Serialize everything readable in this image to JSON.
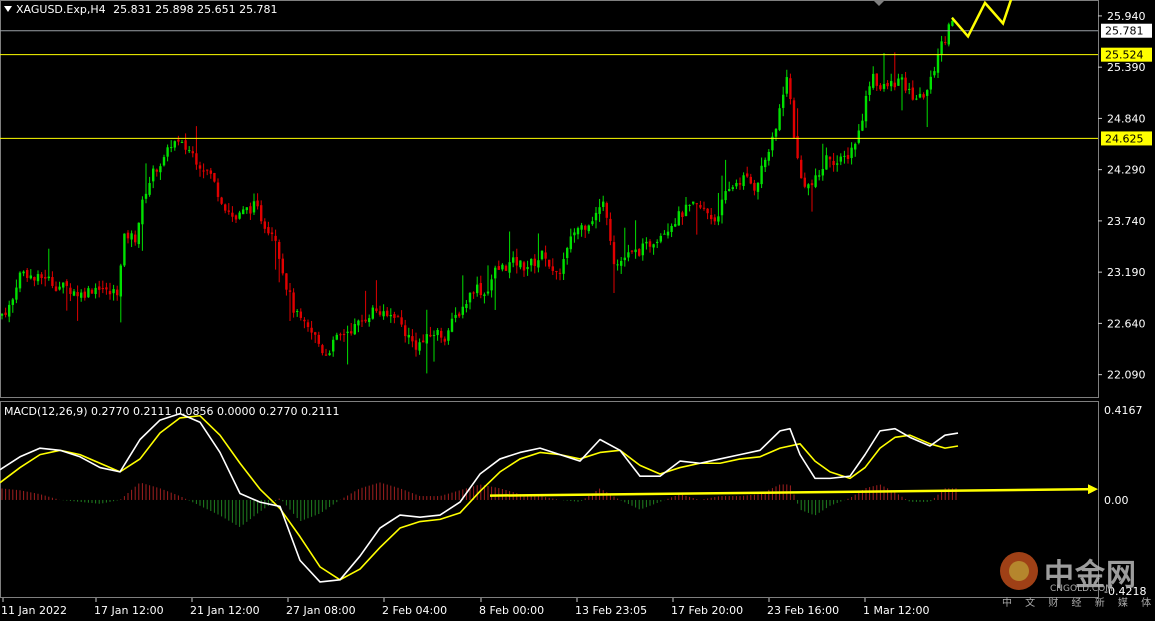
{
  "header": {
    "symbol": "XAGUSD.Exp,H4",
    "ohlc": "25.831 25.898 25.651 25.781"
  },
  "macd": {
    "label": "MACD(12,26,9) 0.2770 0.2111 0.0856 0.0000 0.2770 0.2111",
    "axis_labels": [
      "0.4167",
      "0.00",
      "-0.4218"
    ]
  },
  "watermark": {
    "brand": "中金网",
    "site": "CNGOLD.COM",
    "tagline": "中 文 财 经 新 媒 体"
  },
  "colors": {
    "background": "#000000",
    "bull_candle": "#00e000",
    "bear_candle": "#e00000",
    "level_line": "#ffff00",
    "current_price_line": "#9aa0a6",
    "macd_line": "#ffffff",
    "signal_line": "#ffff00",
    "hist_positive": "#a02020",
    "hist_negative": "#208020",
    "arrow": "#ffff00"
  },
  "chart_data": [
    {
      "type": "candlestick",
      "title": "XAGUSD.Exp,H4",
      "y_ticks": [
        22.09,
        22.64,
        23.19,
        23.74,
        24.29,
        24.84,
        25.39,
        25.94
      ],
      "ylim": [
        21.85,
        26.1
      ],
      "x_ticks": [
        "11 Jan 2022",
        "17 Jan 12:00",
        "21 Jan 12:00",
        "27 Jan 08:00",
        "2 Feb 04:00",
        "8 Feb 00:00",
        "13 Feb 23:05",
        "17 Feb 20:00",
        "23 Feb 16:00",
        "1 Mar 12:00"
      ],
      "current_price": 25.781,
      "current_price_label": "25.781",
      "levels": [
        {
          "value": 25.524,
          "label": "25.524"
        },
        {
          "value": 24.625,
          "label": "24.625"
        }
      ],
      "close_path": [
        [
          0,
          22.72
        ],
        [
          12,
          22.85
        ],
        [
          18,
          23.15
        ],
        [
          25,
          23.2
        ],
        [
          35,
          23.1
        ],
        [
          45,
          23.15
        ],
        [
          55,
          23.05
        ],
        [
          68,
          23.02
        ],
        [
          80,
          22.95
        ],
        [
          90,
          23.0
        ],
        [
          100,
          23.05
        ],
        [
          108,
          22.95
        ],
        [
          118,
          23.0
        ],
        [
          125,
          23.6
        ],
        [
          135,
          23.55
        ],
        [
          145,
          24.05
        ],
        [
          155,
          24.3
        ],
        [
          165,
          24.4
        ],
        [
          172,
          24.6
        ],
        [
          180,
          24.55
        ],
        [
          190,
          24.5
        ],
        [
          200,
          24.35
        ],
        [
          210,
          24.25
        ],
        [
          218,
          24.05
        ],
        [
          225,
          23.9
        ],
        [
          235,
          23.75
        ],
        [
          245,
          23.85
        ],
        [
          255,
          23.9
        ],
        [
          265,
          23.7
        ],
        [
          275,
          23.6
        ],
        [
          285,
          23.1
        ],
        [
          295,
          22.75
        ],
        [
          305,
          22.6
        ],
        [
          315,
          22.5
        ],
        [
          325,
          22.3
        ],
        [
          335,
          22.45
        ],
        [
          345,
          22.55
        ],
        [
          355,
          22.6
        ],
        [
          365,
          22.7
        ],
        [
          375,
          22.8
        ],
        [
          385,
          22.7
        ],
        [
          395,
          22.75
        ],
        [
          405,
          22.55
        ],
        [
          415,
          22.4
        ],
        [
          425,
          22.45
        ],
        [
          435,
          22.55
        ],
        [
          445,
          22.5
        ],
        [
          455,
          22.7
        ],
        [
          465,
          22.85
        ],
        [
          475,
          23.05
        ],
        [
          485,
          22.95
        ],
        [
          495,
          23.2
        ],
        [
          505,
          23.25
        ],
        [
          515,
          23.3
        ],
        [
          525,
          23.25
        ],
        [
          535,
          23.3
        ],
        [
          545,
          23.4
        ],
        [
          555,
          23.1
        ],
        [
          565,
          23.35
        ],
        [
          575,
          23.65
        ],
        [
          585,
          23.7
        ],
        [
          595,
          23.8
        ],
        [
          605,
          23.95
        ],
        [
          615,
          23.25
        ],
        [
          625,
          23.35
        ],
        [
          635,
          23.4
        ],
        [
          645,
          23.45
        ],
        [
          655,
          23.55
        ],
        [
          665,
          23.65
        ],
        [
          675,
          23.75
        ],
        [
          685,
          23.85
        ],
        [
          695,
          23.9
        ],
        [
          705,
          23.85
        ],
        [
          715,
          23.75
        ],
        [
          725,
          24.0
        ],
        [
          735,
          24.15
        ],
        [
          745,
          24.2
        ],
        [
          755,
          24.1
        ],
        [
          765,
          24.4
        ],
        [
          775,
          24.65
        ],
        [
          782,
          25.1
        ],
        [
          788,
          25.3
        ],
        [
          793,
          24.75
        ],
        [
          800,
          24.2
        ],
        [
          810,
          24.1
        ],
        [
          818,
          24.2
        ],
        [
          828,
          24.45
        ],
        [
          838,
          24.35
        ],
        [
          848,
          24.45
        ],
        [
          858,
          24.65
        ],
        [
          865,
          25.0
        ],
        [
          872,
          25.35
        ],
        [
          880,
          25.15
        ],
        [
          890,
          25.2
        ],
        [
          900,
          25.25
        ],
        [
          910,
          25.1
        ],
        [
          920,
          25.05
        ],
        [
          930,
          25.2
        ],
        [
          938,
          25.55
        ],
        [
          945,
          25.7
        ],
        [
          950,
          25.95
        ],
        [
          955,
          25.78
        ]
      ],
      "forecast_arrow_path": [
        [
          952,
          25.92
        ],
        [
          968,
          25.72
        ],
        [
          985,
          26.08
        ],
        [
          1003,
          25.86
        ],
        [
          1020,
          26.4
        ]
      ]
    },
    {
      "type": "macd",
      "title": "MACD(12,26,9)",
      "params": [
        12,
        26,
        9
      ],
      "values": {
        "macd": 0.277,
        "signal": 0.2111,
        "histogram": 0.0856
      },
      "ylim": [
        -0.4218,
        0.4167
      ],
      "macd_line": [
        [
          0,
          0.14
        ],
        [
          20,
          0.2
        ],
        [
          40,
          0.24
        ],
        [
          60,
          0.23
        ],
        [
          80,
          0.2
        ],
        [
          100,
          0.15
        ],
        [
          120,
          0.13
        ],
        [
          140,
          0.28
        ],
        [
          160,
          0.37
        ],
        [
          180,
          0.4
        ],
        [
          200,
          0.36
        ],
        [
          220,
          0.22
        ],
        [
          240,
          0.03
        ],
        [
          260,
          -0.01
        ],
        [
          280,
          -0.03
        ],
        [
          300,
          -0.28
        ],
        [
          320,
          -0.38
        ],
        [
          340,
          -0.37
        ],
        [
          360,
          -0.26
        ],
        [
          380,
          -0.13
        ],
        [
          400,
          -0.07
        ],
        [
          420,
          -0.08
        ],
        [
          440,
          -0.07
        ],
        [
          460,
          -0.01
        ],
        [
          480,
          0.12
        ],
        [
          500,
          0.19
        ],
        [
          520,
          0.22
        ],
        [
          540,
          0.24
        ],
        [
          560,
          0.21
        ],
        [
          580,
          0.18
        ],
        [
          600,
          0.28
        ],
        [
          620,
          0.23
        ],
        [
          640,
          0.11
        ],
        [
          660,
          0.11
        ],
        [
          680,
          0.18
        ],
        [
          700,
          0.17
        ],
        [
          720,
          0.19
        ],
        [
          740,
          0.21
        ],
        [
          760,
          0.23
        ],
        [
          780,
          0.32
        ],
        [
          790,
          0.33
        ],
        [
          800,
          0.21
        ],
        [
          815,
          0.1
        ],
        [
          830,
          0.1
        ],
        [
          850,
          0.11
        ],
        [
          865,
          0.21
        ],
        [
          880,
          0.32
        ],
        [
          895,
          0.33
        ],
        [
          910,
          0.29
        ],
        [
          930,
          0.25
        ],
        [
          945,
          0.3
        ],
        [
          958,
          0.31
        ]
      ],
      "signal_line": [
        [
          0,
          0.08
        ],
        [
          20,
          0.15
        ],
        [
          40,
          0.21
        ],
        [
          60,
          0.23
        ],
        [
          80,
          0.21
        ],
        [
          100,
          0.17
        ],
        [
          120,
          0.13
        ],
        [
          140,
          0.19
        ],
        [
          160,
          0.31
        ],
        [
          180,
          0.38
        ],
        [
          200,
          0.39
        ],
        [
          220,
          0.3
        ],
        [
          240,
          0.17
        ],
        [
          260,
          0.05
        ],
        [
          280,
          -0.04
        ],
        [
          300,
          -0.17
        ],
        [
          320,
          -0.31
        ],
        [
          340,
          -0.37
        ],
        [
          360,
          -0.32
        ],
        [
          380,
          -0.22
        ],
        [
          400,
          -0.13
        ],
        [
          420,
          -0.1
        ],
        [
          440,
          -0.09
        ],
        [
          460,
          -0.06
        ],
        [
          480,
          0.04
        ],
        [
          500,
          0.13
        ],
        [
          520,
          0.19
        ],
        [
          540,
          0.22
        ],
        [
          560,
          0.21
        ],
        [
          580,
          0.19
        ],
        [
          600,
          0.22
        ],
        [
          620,
          0.23
        ],
        [
          640,
          0.16
        ],
        [
          660,
          0.12
        ],
        [
          680,
          0.15
        ],
        [
          700,
          0.17
        ],
        [
          720,
          0.17
        ],
        [
          740,
          0.19
        ],
        [
          760,
          0.2
        ],
        [
          780,
          0.24
        ],
        [
          800,
          0.26
        ],
        [
          815,
          0.18
        ],
        [
          830,
          0.13
        ],
        [
          850,
          0.1
        ],
        [
          865,
          0.15
        ],
        [
          880,
          0.24
        ],
        [
          895,
          0.29
        ],
        [
          910,
          0.3
        ],
        [
          930,
          0.26
        ],
        [
          945,
          0.24
        ],
        [
          958,
          0.25
        ]
      ],
      "zero_arrow_path": [
        [
          490,
          0.02
        ],
        [
          1095,
          0.05
        ]
      ]
    }
  ]
}
